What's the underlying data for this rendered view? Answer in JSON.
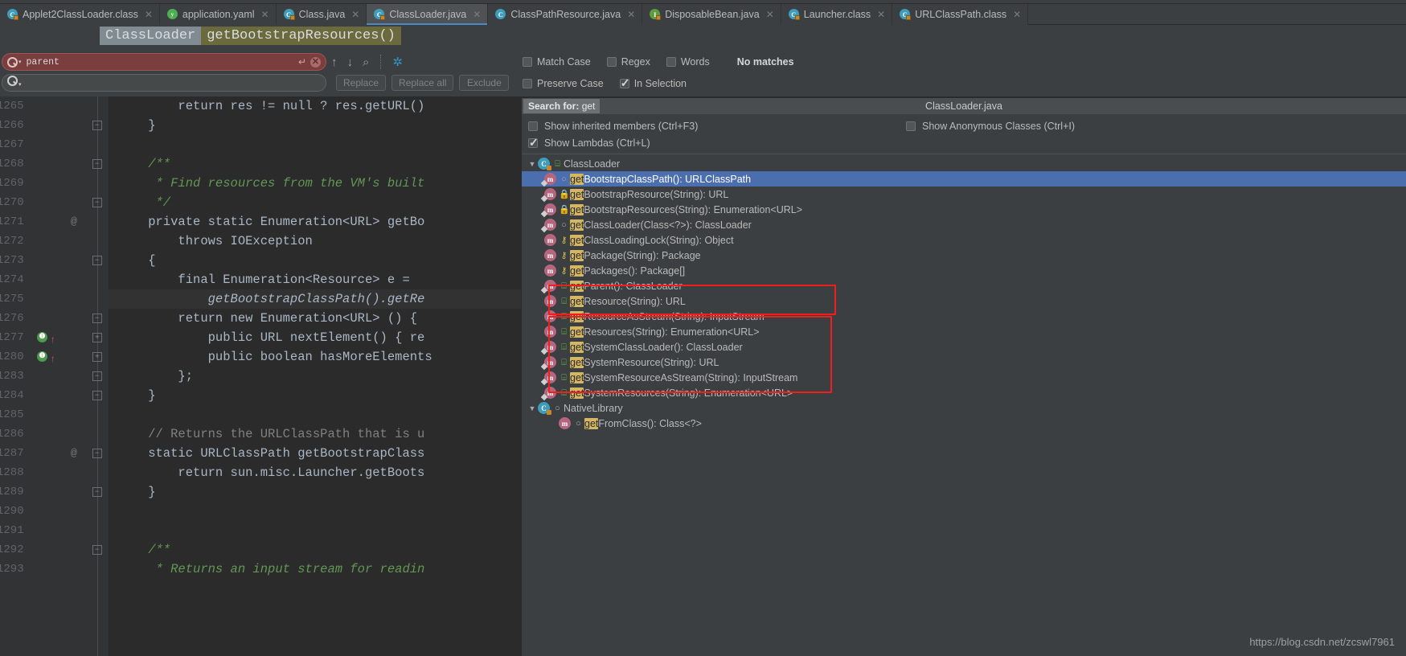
{
  "tabs": [
    {
      "label": "Applet2ClassLoader.class",
      "icon": "class-file-icon"
    },
    {
      "label": "application.yaml",
      "icon": "yaml-file-icon"
    },
    {
      "label": "Class.java",
      "icon": "class-file-icon"
    },
    {
      "label": "ClassLoader.java",
      "icon": "class-file-icon"
    },
    {
      "label": "ClassPathResource.java",
      "icon": "java-file-icon"
    },
    {
      "label": "DisposableBean.java",
      "icon": "interface-file-icon"
    },
    {
      "label": "Launcher.class",
      "icon": "class-file-icon"
    },
    {
      "label": "URLClassPath.class",
      "icon": "class-file-icon"
    }
  ],
  "breadcrumb": {
    "class_name": "ClassLoader",
    "method_name": "getBootstrapResources()"
  },
  "find": {
    "search_value": "parent",
    "replace_value": "",
    "replace_placeholder": "",
    "replace_label": "Replace",
    "replace_all_label": "Replace all",
    "exclude_label": "Exclude",
    "status": "No matches",
    "options": {
      "match_case": "Match Case",
      "regex": "Regex",
      "words": "Words",
      "preserve_case": "Preserve Case",
      "in_selection": "In Selection"
    }
  },
  "editor": {
    "lines": [
      {
        "num": "1265",
        "text": "        return res != null ? res.getURL()"
      },
      {
        "num": "1266",
        "text": "    }"
      },
      {
        "num": "1267",
        "text": ""
      },
      {
        "num": "1268",
        "text": "    /**"
      },
      {
        "num": "1269",
        "text": "     * Find resources from the VM's built"
      },
      {
        "num": "1270",
        "text": "     */"
      },
      {
        "num": "1271",
        "text": "    private static Enumeration<URL> getBo"
      },
      {
        "num": "1272",
        "text": "        throws IOException"
      },
      {
        "num": "1273",
        "text": "    {"
      },
      {
        "num": "1274",
        "text": "        final Enumeration<Resource> e ="
      },
      {
        "num": "1275",
        "text": "            getBootstrapClassPath().getRe"
      },
      {
        "num": "1276",
        "text": "        return new Enumeration<URL> () {"
      },
      {
        "num": "1277",
        "text": "            public URL nextElement() { re"
      },
      {
        "num": "1280",
        "text": "            public boolean hasMoreElements"
      },
      {
        "num": "1283",
        "text": "        };"
      },
      {
        "num": "1284",
        "text": "    }"
      },
      {
        "num": "1285",
        "text": ""
      },
      {
        "num": "1286",
        "text": "    // Returns the URLClassPath that is u"
      },
      {
        "num": "1287",
        "text": "    static URLClassPath getBootstrapClass"
      },
      {
        "num": "1288",
        "text": "        return sun.misc.Launcher.getBoots"
      },
      {
        "num": "1289",
        "text": "    }"
      },
      {
        "num": "1290",
        "text": ""
      },
      {
        "num": "1291",
        "text": ""
      },
      {
        "num": "1292",
        "text": "    /**"
      },
      {
        "num": "1293",
        "text": "     * Returns an input stream for readin"
      }
    ]
  },
  "structure": {
    "search_for_label": "Search for:",
    "search_query": "get",
    "title": "ClassLoader.java",
    "options": {
      "show_inherited": "Show inherited members (Ctrl+F3)",
      "show_lambdas": "Show Lambdas (Ctrl+L)",
      "show_anonymous": "Show Anonymous Classes (Ctrl+I)"
    },
    "tree": [
      {
        "label": "ClassLoader",
        "kind": "class",
        "visibility": "public",
        "expanded": true
      },
      {
        "hit": "get",
        "rest": "BootstrapClassPath(): URLClassPath",
        "kind": "method",
        "visibility": "package-private",
        "selected": true
      },
      {
        "hit": "get",
        "rest": "BootstrapResource(String): URL",
        "kind": "method",
        "visibility": "private"
      },
      {
        "hit": "get",
        "rest": "BootstrapResources(String): Enumeration<URL>",
        "kind": "method",
        "visibility": "private"
      },
      {
        "hit": "get",
        "rest": "ClassLoader(Class<?>): ClassLoader",
        "kind": "method",
        "visibility": "package-private"
      },
      {
        "hit": "get",
        "rest": "ClassLoadingLock(String): Object",
        "kind": "method",
        "visibility": "protected"
      },
      {
        "hit": "get",
        "rest": "Package(String): Package",
        "kind": "method",
        "visibility": "protected"
      },
      {
        "hit": "get",
        "rest": "Packages(): Package[]",
        "kind": "method",
        "visibility": "protected"
      },
      {
        "hit": "get",
        "rest": "Parent(): ClassLoader",
        "kind": "method",
        "visibility": "public"
      },
      {
        "hit": "get",
        "rest": "Resource(String): URL",
        "kind": "method",
        "visibility": "public"
      },
      {
        "hit": "get",
        "rest": "ResourceAsStream(String): InputStream",
        "kind": "method",
        "visibility": "public"
      },
      {
        "hit": "get",
        "rest": "Resources(String): Enumeration<URL>",
        "kind": "method",
        "visibility": "public"
      },
      {
        "hit": "get",
        "rest": "SystemClassLoader(): ClassLoader",
        "kind": "method",
        "visibility": "public"
      },
      {
        "hit": "get",
        "rest": "SystemResource(String): URL",
        "kind": "method",
        "visibility": "public"
      },
      {
        "hit": "get",
        "rest": "SystemResourceAsStream(String): InputStream",
        "kind": "method",
        "visibility": "public"
      },
      {
        "hit": "get",
        "rest": "SystemResources(String): Enumeration<URL>",
        "kind": "method",
        "visibility": "public"
      },
      {
        "label": "NativeLibrary",
        "kind": "class",
        "visibility": "package-private",
        "expanded": true
      },
      {
        "hit": "get",
        "rest": "FromClass(): Class<?>",
        "kind": "method",
        "visibility": "package-private"
      }
    ],
    "annotations": [
      {
        "name": "resource-methods-box",
        "color": "#f01e1e"
      },
      {
        "name": "system-resource-methods-box",
        "color": "#f01e1e"
      }
    ]
  },
  "watermark": "https://blog.csdn.net/zcswl7961"
}
